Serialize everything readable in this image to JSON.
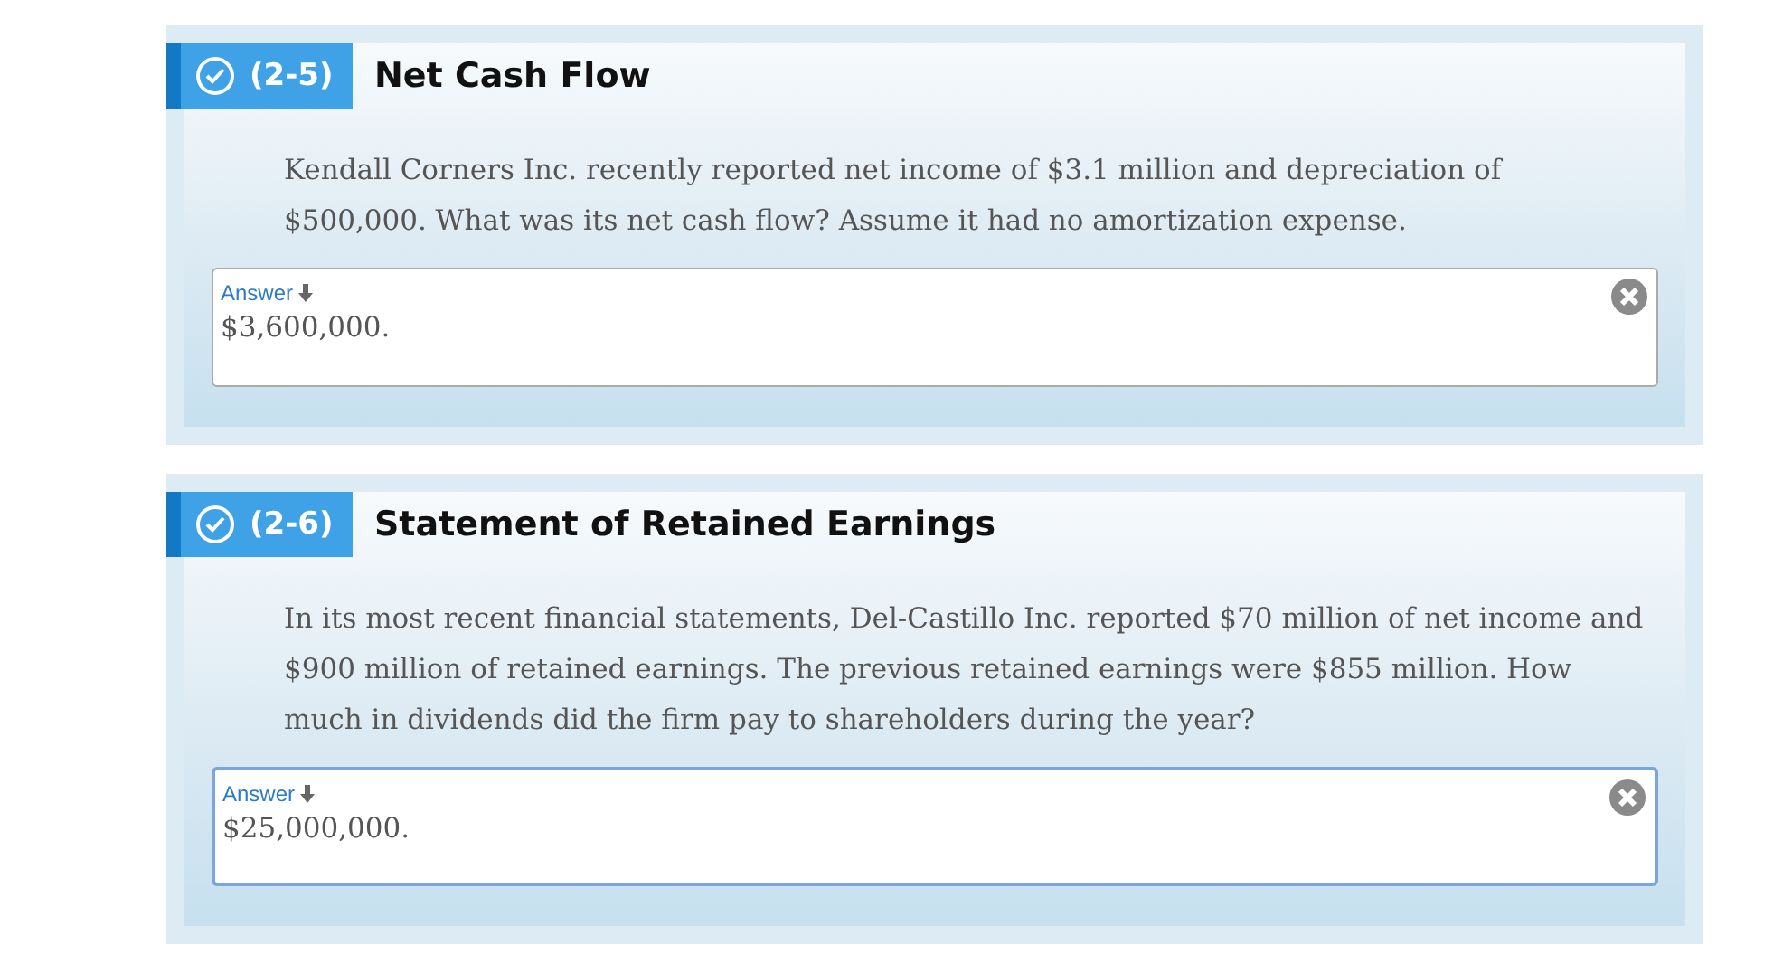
{
  "questions": [
    {
      "number": "(2-5)",
      "title": "Net Cash Flow",
      "checked": true,
      "text": "Kendall Corners Inc. recently reported net income of $3.1 million and depreciation of $500,000. What was its net cash flow? Assume it had no amortization expense.",
      "answer": {
        "label": "Answer",
        "value": "$3,600,000.",
        "focused": false
      }
    },
    {
      "number": "(2-6)",
      "title": "Statement of Retained Earnings",
      "checked": true,
      "text": "In its most recent financial statements, Del-Castillo Inc. reported $70 million of net income and $900 million of retained earnings. The previous retained earnings were $855 million. How much in dividends did the firm pay to shareholders during the year?",
      "answer": {
        "label": "Answer",
        "value": "$25,000,000.",
        "focused": true
      }
    }
  ]
}
